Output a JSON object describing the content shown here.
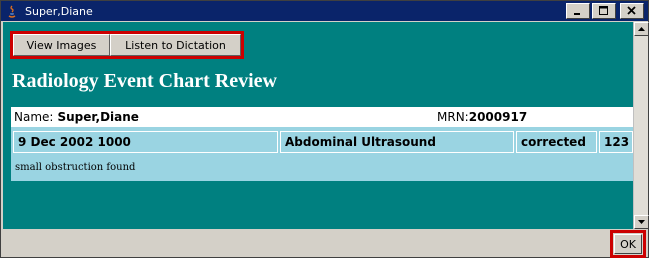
{
  "window": {
    "title": "Super,Diane"
  },
  "toolbar": {
    "view_images_label": "View Images",
    "listen_label": "Listen to Dictation"
  },
  "main": {
    "heading": "Radiology Event Chart Review"
  },
  "patient": {
    "name_label": "Name:",
    "name_value": "Super,Diane",
    "mrn_label": "MRN:",
    "mrn_value": "2000917"
  },
  "event": {
    "datetime": "9 Dec 2002 1000",
    "exam": "Abdominal Ultrasound",
    "status": "corrected",
    "number": "123",
    "finding": "small obstruction found"
  },
  "footer": {
    "ok_label": "OK"
  },
  "colors": {
    "background": "#008080",
    "row": "#9ad4e2",
    "highlight": "#cc0000",
    "titlebar": "#0a246a"
  }
}
